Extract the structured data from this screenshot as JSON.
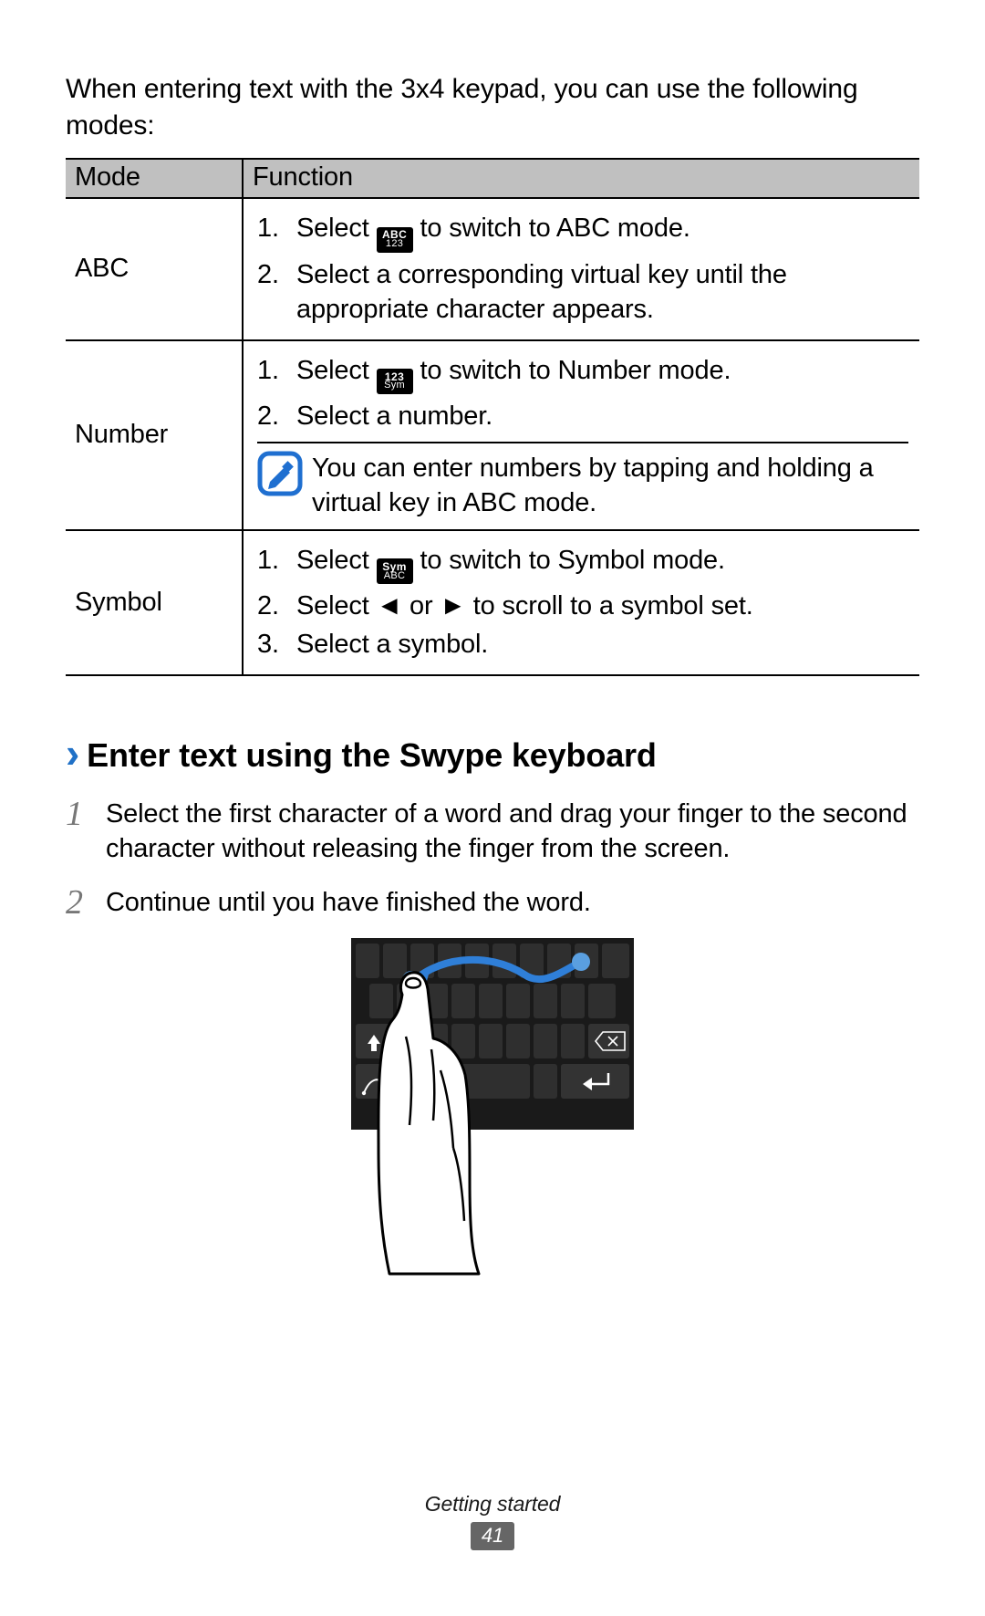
{
  "intro": "When entering text with the 3x4 keypad, you can use the following modes:",
  "table": {
    "headers": {
      "mode": "Mode",
      "function": "Function"
    },
    "rows": [
      {
        "mode": "ABC",
        "steps": [
          {
            "pre": "Select ",
            "icon": {
              "line1": "ABC",
              "line2": "123"
            },
            "post": " to switch to ABC mode."
          },
          {
            "text": "Select a corresponding virtual key until the appropriate character appears."
          }
        ]
      },
      {
        "mode": "Number",
        "steps": [
          {
            "pre": "Select ",
            "icon": {
              "line1": "123",
              "line2": "Sym"
            },
            "post": " to switch to Number mode."
          },
          {
            "text": "Select a number."
          }
        ],
        "note": "You can enter numbers by tapping and holding a virtual key in ABC mode."
      },
      {
        "mode": "Symbol",
        "steps": [
          {
            "pre": "Select ",
            "icon": {
              "line1": "Sym",
              "line2": "ABC"
            },
            "post": " to switch to Symbol mode."
          },
          {
            "text": "Select ◄ or ► to scroll to a symbol set."
          },
          {
            "text": "Select a symbol."
          }
        ]
      }
    ]
  },
  "section": {
    "chevron": "›",
    "title": "Enter text using the Swype keyboard",
    "steps": [
      "Select the first character of a word and drag your finger to the second character without releasing the finger from the screen.",
      "Continue until you have finished the word."
    ]
  },
  "footer": {
    "label": "Getting started",
    "page": "41"
  }
}
